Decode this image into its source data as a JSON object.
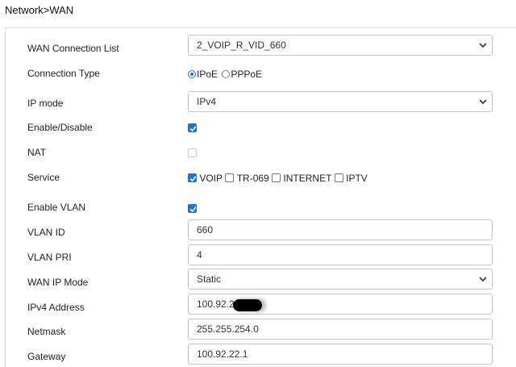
{
  "breadcrumb": "Network>WAN",
  "fields": {
    "wan_connection_list": {
      "label": "WAN Connection List",
      "value": "2_VOIP_R_VID_660"
    },
    "connection_type": {
      "label": "Connection Type",
      "options": [
        "IPoE",
        "PPPoE"
      ],
      "selected": "IPoE"
    },
    "ip_mode": {
      "label": "IP mode",
      "value": "IPv4"
    },
    "enable_disable": {
      "label": "Enable/Disable",
      "checked": true
    },
    "nat": {
      "label": "NAT",
      "checked": false,
      "disabled": true
    },
    "service": {
      "label": "Service",
      "options": [
        {
          "label": "VOIP",
          "checked": true
        },
        {
          "label": "TR-069",
          "checked": false
        },
        {
          "label": "INTERNET",
          "checked": false
        },
        {
          "label": "IPTV",
          "checked": false
        }
      ]
    },
    "enable_vlan": {
      "label": "Enable VLAN",
      "checked": true
    },
    "vlan_id": {
      "label": "VLAN ID",
      "value": "660"
    },
    "vlan_pri": {
      "label": "VLAN PRI",
      "value": "4"
    },
    "wan_ip_mode": {
      "label": "WAN IP Mode",
      "value": "Static"
    },
    "ipv4_address": {
      "label": "IPv4 Address",
      "value": "100.92.22"
    },
    "netmask": {
      "label": "Netmask",
      "value": "255.255.254.0"
    },
    "gateway": {
      "label": "Gateway",
      "value": "100.92.22.1"
    }
  },
  "colors": {
    "accent": "#1a73e8",
    "border": "#c4c4c4"
  }
}
